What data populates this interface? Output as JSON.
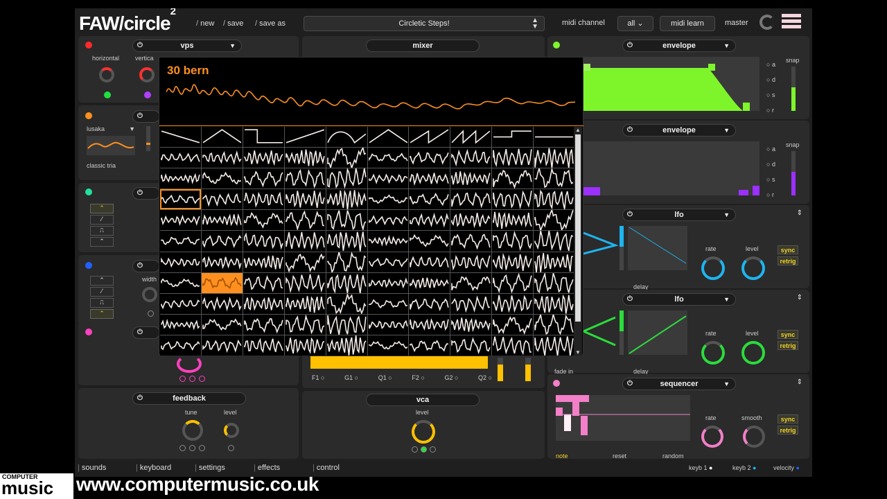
{
  "header": {
    "logo_main": "FAW/circle",
    "logo_sup": "2",
    "links": [
      "new",
      "save",
      "save as"
    ],
    "preset_name": "Circletic Steps!",
    "midi_channel_label": "midi channel",
    "midi_channel_value": "all",
    "midi_learn": "midi learn",
    "master_label": "master"
  },
  "left": {
    "vps_title": "vps",
    "horizontal": "horizontal",
    "vertical": "vertica",
    "osc_select": "lusaka",
    "osc_wave": "classic tria",
    "width_label": "width",
    "feedback_title": "feedback",
    "tune": "tune",
    "level": "level"
  },
  "center": {
    "mixer_title": "mixer",
    "filter_labels": [
      "F1",
      "G1",
      "Q1",
      "F2",
      "G2",
      "Q2"
    ],
    "vca_title": "vca",
    "vca_level": "level"
  },
  "right": {
    "env1_title": "envelope",
    "env2_title": "envelope",
    "env_opts": [
      "a",
      "d",
      "s",
      "r"
    ],
    "snap": "snap",
    "lfo1_title": "lfo",
    "lfo2_title": "lfo",
    "rate": "rate",
    "level": "level",
    "sync": "sync",
    "retrig": "retrig",
    "delay": "delay",
    "fade_in": "fade in",
    "seq_title": "sequencer",
    "smooth": "smooth",
    "note": "note",
    "reset": "reset",
    "random": "random"
  },
  "overlay": {
    "wave_name": "30 bern"
  },
  "footer": {
    "tabs": [
      "sounds",
      "keyboard",
      "settings",
      "effects",
      "control"
    ],
    "keyb1": "keyb 1",
    "keyb2": "keyb 2",
    "velocity": "velocity"
  },
  "branding": {
    "cm_top": "COMPUTER",
    "cm_main": "music",
    "url": "www.computermusic.co.uk"
  },
  "colors": {
    "accent_orange": "#ff9020",
    "env_green": "#7df52a",
    "env_purple": "#9b30ff",
    "lfo_blue": "#1eb4f0",
    "lfo_green": "#2bdc3c",
    "seq_pink": "#f27fc8",
    "mixer_yellow": "#ffc000"
  }
}
